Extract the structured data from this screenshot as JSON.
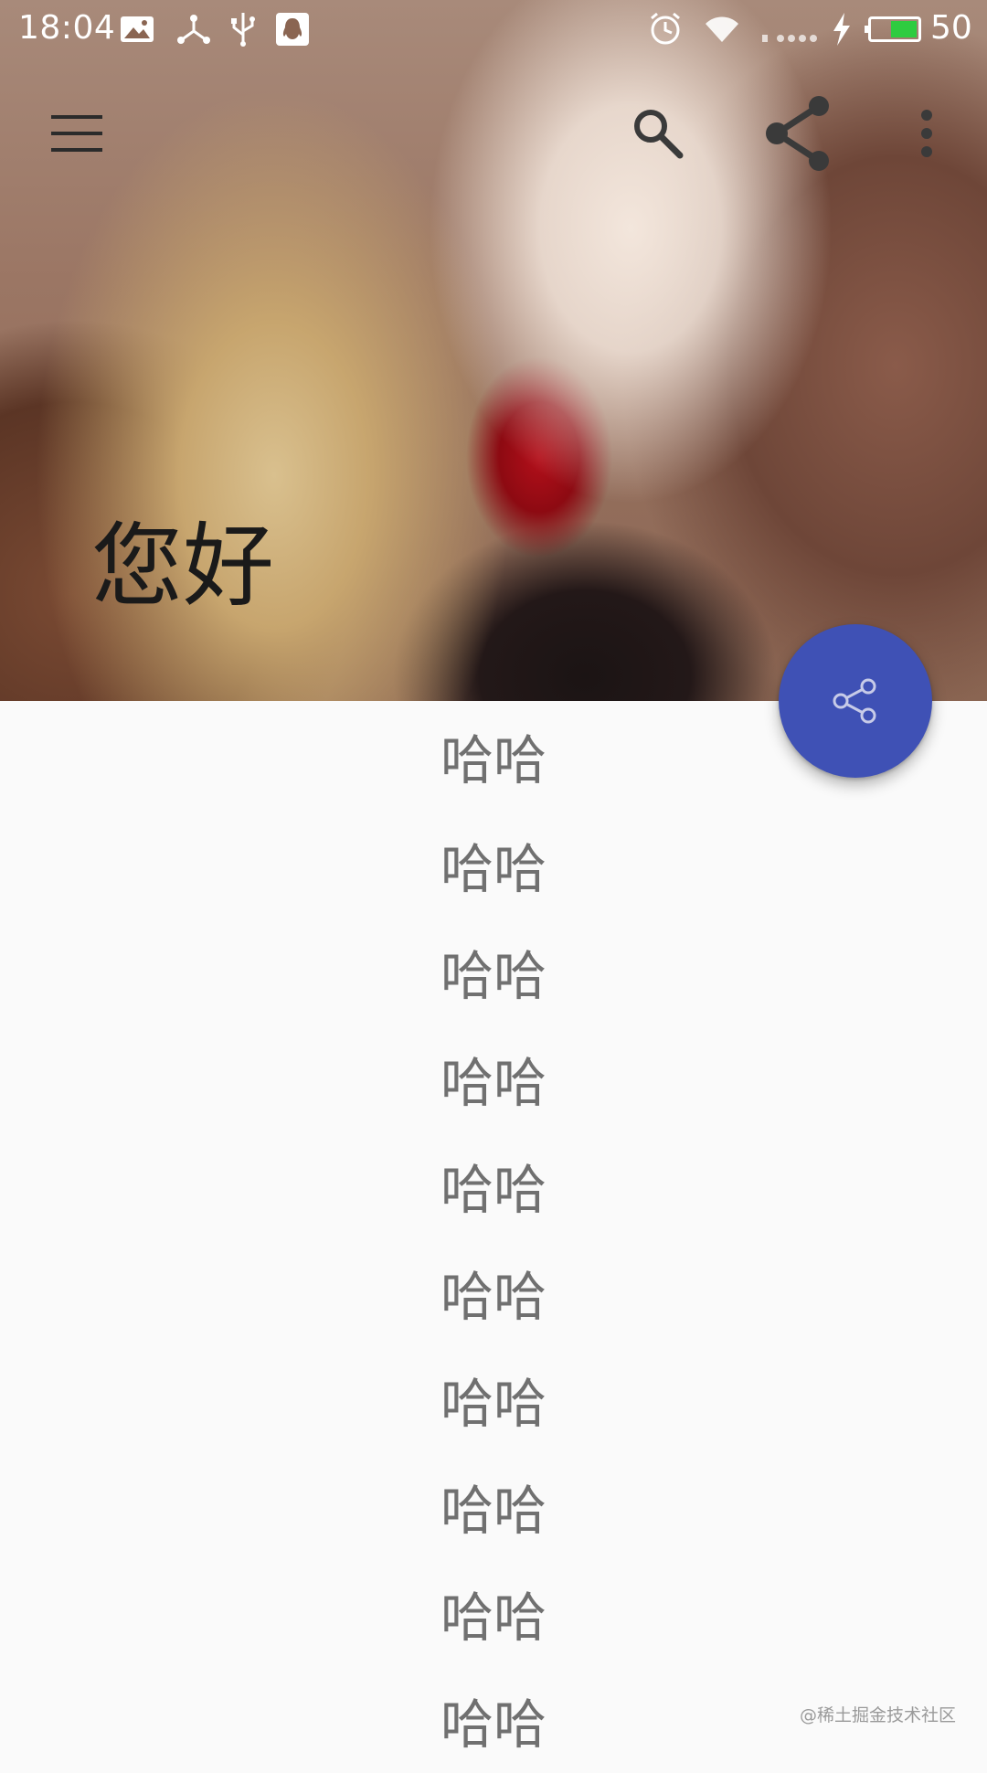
{
  "status_bar": {
    "time": "18:04",
    "battery_percent": "50",
    "icons": [
      "image-icon",
      "share-network-icon",
      "usb-icon",
      "qq-icon",
      "alarm-icon",
      "wifi-icon",
      "signal-icon",
      "charging-icon",
      "battery-icon"
    ]
  },
  "toolbar": {
    "icons": [
      "menu-icon",
      "search-icon",
      "share-icon",
      "more-vert-icon"
    ]
  },
  "header": {
    "title": "您好"
  },
  "fab": {
    "icon": "share-icon",
    "color": "#3f51b5"
  },
  "list": {
    "items": [
      "哈哈",
      "哈哈",
      "哈哈",
      "哈哈",
      "哈哈",
      "哈哈",
      "哈哈",
      "哈哈",
      "哈哈",
      "哈哈"
    ]
  },
  "watermark": "@稀土掘金技术社区"
}
